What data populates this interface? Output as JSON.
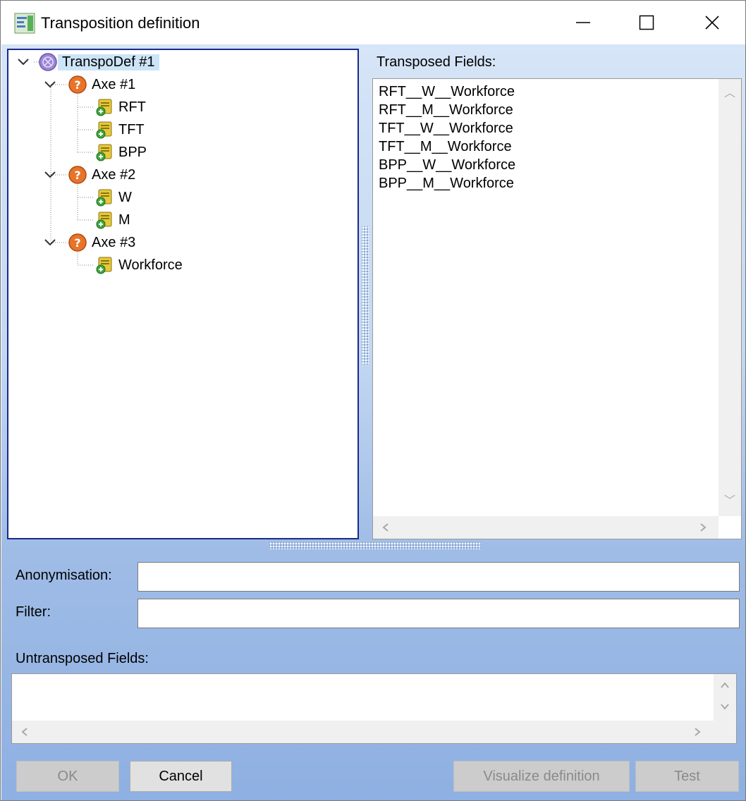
{
  "window": {
    "title": "Transposition definition"
  },
  "tree": {
    "root": {
      "label": "TranspoDef #1",
      "icon": "root-node-icon"
    },
    "axes": [
      {
        "label": "Axe #1",
        "icon": "question-node-icon",
        "children": [
          "RFT",
          "TFT",
          "BPP"
        ]
      },
      {
        "label": "Axe #2",
        "icon": "question-node-icon",
        "children": [
          "W",
          "M"
        ]
      },
      {
        "label": "Axe #3",
        "icon": "question-node-icon",
        "children": [
          "Workforce"
        ]
      }
    ]
  },
  "transposed": {
    "label": "Transposed Fields:",
    "lines": [
      "RFT__W__Workforce",
      "RFT__M__Workforce",
      "TFT__W__Workforce",
      "TFT__M__Workforce",
      "BPP__W__Workforce",
      "BPP__M__Workforce"
    ]
  },
  "form": {
    "anonymisation_label": "Anonymisation:",
    "anonymisation_value": "",
    "filter_label": "Filter:",
    "filter_value": ""
  },
  "untransposed": {
    "label": "Untransposed Fields:",
    "value": ""
  },
  "buttons": {
    "ok": "OK",
    "cancel": "Cancel",
    "visualize": "Visualize definition",
    "test": "Test"
  },
  "colors": {
    "selection": "#cce4f7",
    "tree_border": "#1b2a8a",
    "question_icon": "#e8742a",
    "root_icon": "#9b86d4",
    "leaf_icon": "#e6c93a"
  }
}
